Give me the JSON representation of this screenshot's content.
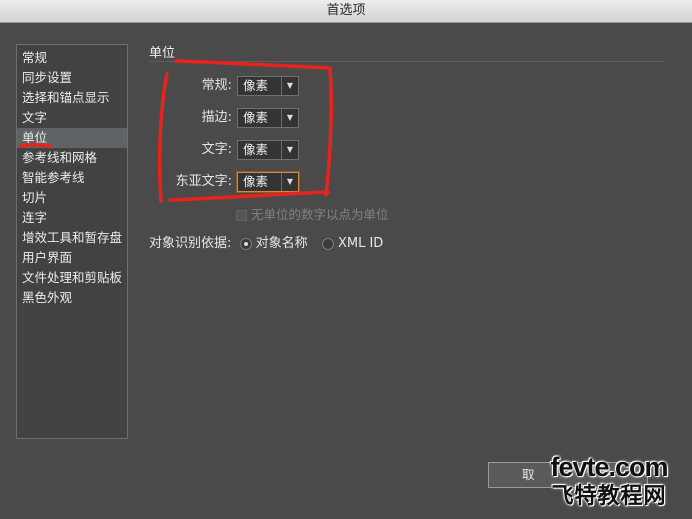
{
  "window": {
    "title": "首选项"
  },
  "sidebar": {
    "items": [
      {
        "label": "常规"
      },
      {
        "label": "同步设置"
      },
      {
        "label": "选择和锚点显示"
      },
      {
        "label": "文字"
      },
      {
        "label": "单位",
        "selected": true
      },
      {
        "label": "参考线和网格"
      },
      {
        "label": "智能参考线"
      },
      {
        "label": "切片"
      },
      {
        "label": "连字"
      },
      {
        "label": "增效工具和暂存盘"
      },
      {
        "label": "用户界面"
      },
      {
        "label": "文件处理和剪贴板"
      },
      {
        "label": "黑色外观"
      }
    ]
  },
  "units": {
    "section_title": "单位",
    "general_label": "常规:",
    "general_value": "像素",
    "stroke_label": "描边:",
    "stroke_value": "像素",
    "type_label": "文字:",
    "type_value": "像素",
    "asian_type_label": "东亚文字:",
    "asian_type_value": "像素",
    "unitless_checkbox_label": "无单位的数字以点为单位",
    "object_identify_label": "对象识别依据:",
    "radio_object_name": "对象名称",
    "radio_xml_id": "XML ID",
    "object_identify_selected": "对象名称"
  },
  "buttons": {
    "partial_button_label": "取"
  },
  "watermark": {
    "line1": "fevte.com",
    "line2": "飞特教程网"
  },
  "colors": {
    "annotation": "#e8231b",
    "focus": "#d08a3a",
    "background": "#4a4a4a"
  }
}
